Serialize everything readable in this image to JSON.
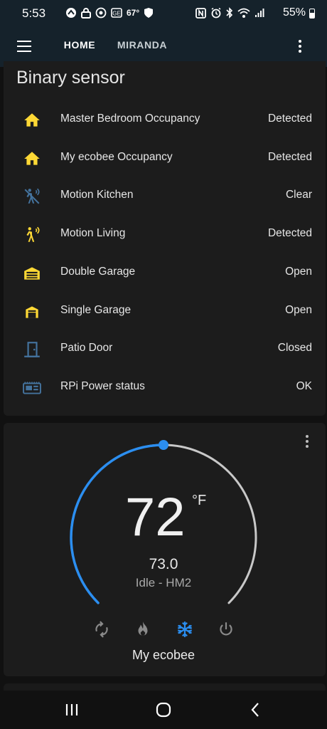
{
  "status_bar": {
    "time": "5:53",
    "temp": "67°",
    "battery": "55%",
    "left_icons": [
      "navigation-icon",
      "lock-icon",
      "camera-icon",
      "g-icon"
    ],
    "right_icons": [
      "nfc-icon",
      "alarm-icon",
      "bluetooth-icon",
      "wifi-icon",
      "signal-icon"
    ]
  },
  "toolbar": {
    "tabs": [
      {
        "label": "HOME",
        "active": true
      },
      {
        "label": "MIRANDA",
        "active": false
      }
    ]
  },
  "binary_sensor": {
    "title": "Binary sensor",
    "rows": [
      {
        "name": "Master Bedroom Occupancy",
        "state": "Detected",
        "icon": "home-icon",
        "color": "#fdd835"
      },
      {
        "name": "My ecobee Occupancy",
        "state": "Detected",
        "icon": "home-icon",
        "color": "#fdd835"
      },
      {
        "name": "Motion Kitchen",
        "state": "Clear",
        "icon": "motion-off-icon",
        "color": "#44739e"
      },
      {
        "name": "Motion Living",
        "state": "Detected",
        "icon": "motion-icon",
        "color": "#fdd835"
      },
      {
        "name": "Double Garage",
        "state": "Open",
        "icon": "garage-open-icon",
        "color": "#fdd835"
      },
      {
        "name": "Single Garage",
        "state": "Open",
        "icon": "garage-open-icon",
        "color": "#fdd835"
      },
      {
        "name": "Patio Door",
        "state": "Closed",
        "icon": "door-closed-icon",
        "color": "#44739e"
      },
      {
        "name": "RPi Power status",
        "state": "OK",
        "icon": "raspberry-pi-icon",
        "color": "#44739e"
      }
    ]
  },
  "thermostat": {
    "setpoint": "72",
    "unit": "°F",
    "current": "73.0",
    "status": "Idle - HM2",
    "name": "My ecobee",
    "setpoint_fraction": 0.5,
    "colors": {
      "active_arc": "#2b8ef0",
      "inactive_arc": "#c8c8c8",
      "cool": "#2b8ef0",
      "inactive_mode": "#8a8a8a"
    },
    "modes": [
      {
        "icon": "autorenew-icon",
        "active": false
      },
      {
        "icon": "fire-icon",
        "active": false
      },
      {
        "icon": "snowflake-icon",
        "active": true
      },
      {
        "icon": "power-icon",
        "active": false
      }
    ]
  },
  "navbar": {
    "buttons": [
      "recent-apps-icon",
      "home-circle-icon",
      "back-icon"
    ]
  }
}
